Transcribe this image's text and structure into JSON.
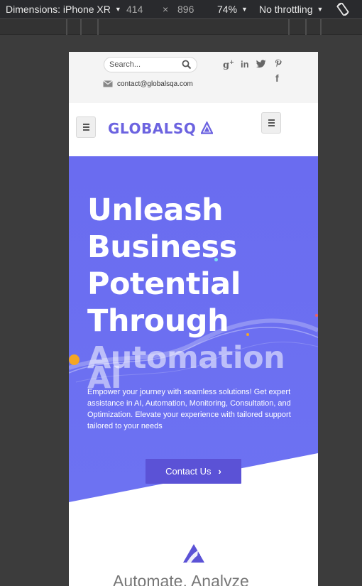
{
  "devtools": {
    "device_label": "Dimensions: iPhone XR",
    "width": "414",
    "times": "×",
    "height": "896",
    "zoom": "74%",
    "throttle": "No throttling"
  },
  "topbar": {
    "search_placeholder": "Search...",
    "email": "contact@globalsqa.com",
    "social_icons": [
      "google-plus-icon",
      "linkedin-icon",
      "twitter-icon",
      "pinterest-icon",
      "facebook-icon"
    ]
  },
  "header": {
    "logo": "GLOBALSQ"
  },
  "hero": {
    "headline": [
      "Unleash",
      "Business",
      "Potential",
      "Through",
      "Automation",
      "AI"
    ],
    "description": "Empower your journey with seamless solutions! Get expert assistance in AI, Automation, Monitoring, Consultation, and Optimization. Elevate your experience with tailored support tailored to your needs",
    "cta": "Contact Us"
  },
  "section": {
    "tagline": "Automate, Analyze"
  },
  "colors": {
    "hero": "#6b6ff0",
    "brand": "#6c63e0",
    "button": "#5b52d6",
    "accent_dot": "#f5a623"
  }
}
